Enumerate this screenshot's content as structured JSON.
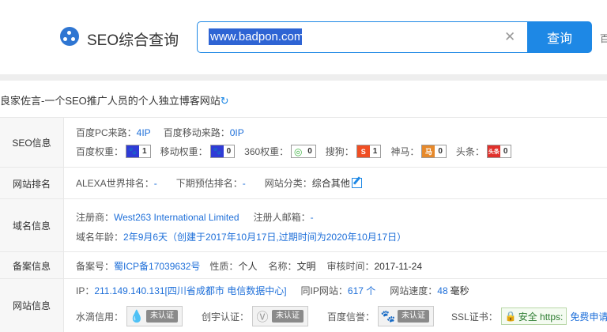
{
  "header": {
    "brand": "SEO综合查询",
    "search_value": "www.badpon.com",
    "query_button": "查询",
    "clipped_text": "百"
  },
  "site_title": "良家佐言-一个SEO推广人员的个人独立博客网站",
  "seo": {
    "label": "SEO信息",
    "pc_source_label": "百度PC来路：",
    "pc_source_value": "4IP",
    "mobile_source_label": "百度移动来路：",
    "mobile_source_value": "0IP",
    "weights": [
      {
        "label": "百度权重：",
        "value": "1",
        "icon": "baidu-paw-icon",
        "color": "#2f3bd6"
      },
      {
        "label": "移动权重：",
        "value": "0",
        "icon": "baidu-paw-icon",
        "color": "#2f3bd6"
      },
      {
        "label": "360权重：",
        "value": "0",
        "icon": "360-icon",
        "color": "#45b649"
      },
      {
        "label": "搜狗：",
        "value": "1",
        "icon": "sogou-icon",
        "color": "#f04e23"
      },
      {
        "label": "神马：",
        "value": "0",
        "icon": "shenma-icon",
        "color": "#e6892b"
      },
      {
        "label": "头条：",
        "value": "0",
        "icon": "toutiao-icon",
        "color": "#e0302b"
      }
    ]
  },
  "rank": {
    "label": "网站排名",
    "alexa_label": "ALEXA世界排名：",
    "alexa_value": "-",
    "predict_label": "下期预估排名：",
    "predict_value": "-",
    "category_label": "网站分类：",
    "category_value": "综合其他"
  },
  "domain": {
    "label": "域名信息",
    "registrar_label": "注册商：",
    "registrar_value": "West263 International Limited",
    "email_label": "注册人邮箱：",
    "email_value": "-",
    "age_label": "域名年龄：",
    "age_value": "2年9月6天（创建于2017年10月17日,过期时间为2020年10月17日）"
  },
  "icp": {
    "label": "备案信息",
    "no_label": "备案号：",
    "no_value": "蜀ICP备17039632号",
    "nature_label": "性质：",
    "nature_value": "个人",
    "name_label": "名称：",
    "name_value": "文明",
    "audit_label": "审核时间：",
    "audit_value": "2017-11-24"
  },
  "siteinfo": {
    "label": "网站信息",
    "ip_label": "IP：",
    "ip_value": "211.149.140.131[四川省成都市 电信数据中心]",
    "sameip_label": "同IP网站：",
    "sameip_value": "617 个",
    "speed_label": "网站速度：",
    "speed_value": "48",
    "speed_unit": "毫秒",
    "certs": [
      {
        "label": "水滴信用：",
        "badge": "未认证",
        "icon": "water-drop-icon"
      },
      {
        "label": "创宇认证：",
        "badge": "未认证",
        "icon": "shield-v-icon"
      },
      {
        "label": "百度信誉：",
        "badge": "未认证",
        "icon": "baidu-paw-icon"
      }
    ],
    "ssl_label": "SSL证书：",
    "ssl_badge": "安全 https:",
    "ssl_apply": "免费申请"
  }
}
